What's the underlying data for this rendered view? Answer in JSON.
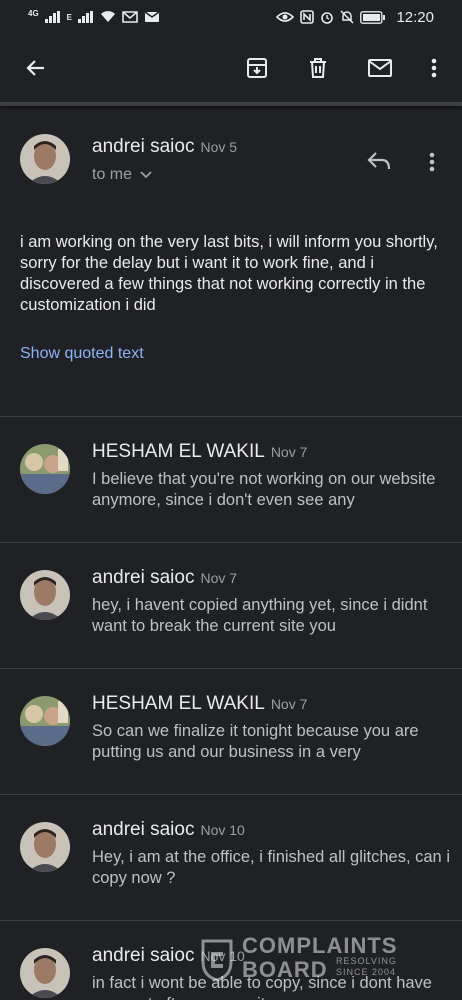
{
  "status_bar": {
    "net1": "4G",
    "net2": "E",
    "time": "12:20"
  },
  "toolbar": {
    "icons": [
      "back-arrow-icon",
      "archive-icon",
      "delete-icon",
      "mark-unread-icon",
      "more-vert-icon"
    ]
  },
  "open_message": {
    "sender": "andrei saioc",
    "date": "Nov 5",
    "recipient": "to me",
    "body": "i am working on the very last bits, i will inform you shortly, sorry for the delay but i want it to work fine, and i discovered a few things that not working correctly in the customization i did",
    "show_quoted": "Show quoted text"
  },
  "thread": [
    {
      "sender": "HESHAM EL WAKIL",
      "date": "Nov 7",
      "snippet": "I believe that you're not working on our website anymore, since i don't even see any"
    },
    {
      "sender": "andrei saioc",
      "date": "Nov 7",
      "snippet": "hey, i havent copied anything yet, since i didnt want to break the current site you"
    },
    {
      "sender": "HESHAM EL WAKIL",
      "date": "Nov 7",
      "snippet": "So can we finalize it tonight because you are putting us and our business in a very"
    },
    {
      "sender": "andrei saioc",
      "date": "Nov 10",
      "snippet": "Hey, i am at the office, i finished all glitches, can i copy now ?"
    },
    {
      "sender": "andrei saioc",
      "date": "Nov 10",
      "snippet": "in fact i wont be able to copy, since i dont have access to ftp on your site"
    }
  ],
  "watermark": {
    "line1": "COMPLAINTS",
    "line2": "BOARD",
    "tag1": "RESOLVING",
    "tag2": "SINCE 2004"
  }
}
